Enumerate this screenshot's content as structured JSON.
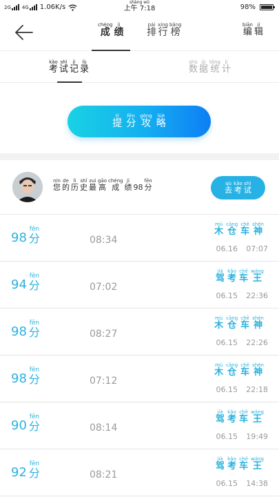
{
  "status_bar": {
    "network_left": "2G",
    "network_right": "4G",
    "speed": "1.06K/s",
    "time_py": "shàng wǔ",
    "time_text": "上午 7:18",
    "battery_text": "98%",
    "battery_level": 0.98
  },
  "header": {
    "tabs": [
      {
        "chars": [
          {
            "py": "chéng",
            "hz": "成"
          },
          {
            "py": "jì",
            "hz": "绩"
          }
        ]
      },
      {
        "chars": [
          {
            "py": "pái",
            "hz": "排"
          },
          {
            "py": "xíng",
            "hz": "行"
          },
          {
            "py": "bǎng",
            "hz": "榜"
          }
        ]
      }
    ],
    "edit": [
      {
        "py": "biān",
        "hz": "编"
      },
      {
        "py": "jí",
        "hz": "辑"
      }
    ]
  },
  "subtabs": [
    {
      "chars": [
        {
          "py": "kǎo",
          "hz": "考"
        },
        {
          "py": "shì",
          "hz": "试"
        },
        {
          "py": "jì",
          "hz": "记"
        },
        {
          "py": "lù",
          "hz": "录"
        }
      ]
    },
    {
      "chars": [
        {
          "py": "shù",
          "hz": "数"
        },
        {
          "py": "jù",
          "hz": "据"
        },
        {
          "py": "tǒng",
          "hz": "统"
        },
        {
          "py": "jì",
          "hz": "计"
        }
      ]
    }
  ],
  "strategy_button": [
    {
      "py": "tí",
      "hz": "提"
    },
    {
      "py": "fēn",
      "hz": "分"
    },
    {
      "py": "gōng",
      "hz": "攻"
    },
    {
      "py": "lüè",
      "hz": "略"
    }
  ],
  "best": {
    "chars": [
      {
        "py": "nín",
        "hz": "您"
      },
      {
        "py": "de",
        "hz": "的"
      },
      {
        "py": "lì",
        "hz": "历"
      },
      {
        "py": "shǐ",
        "hz": "史"
      },
      {
        "py": "zuì",
        "hz": "最"
      },
      {
        "py": "gāo",
        "hz": "高"
      },
      {
        "py": "chéng",
        "hz": "成"
      },
      {
        "py": "jì",
        "hz": "绩"
      }
    ],
    "score": "98",
    "unit": {
      "py": "fēn",
      "hz": "分"
    }
  },
  "exam_button": [
    {
      "py": "qù",
      "hz": "去"
    },
    {
      "py": "kǎo",
      "hz": "考"
    },
    {
      "py": "shì",
      "hz": "试"
    }
  ],
  "score_unit": {
    "py": "fēn",
    "hz": "分"
  },
  "records": [
    {
      "score": "98",
      "duration": "08:34",
      "title": [
        {
          "py": "mù",
          "hz": "木"
        },
        {
          "py": "cāng",
          "hz": "仓"
        },
        {
          "py": "chē",
          "hz": "车"
        },
        {
          "py": "shén",
          "hz": "神"
        }
      ],
      "date": "06.16",
      "time": "07:07"
    },
    {
      "score": "94",
      "duration": "07:02",
      "title": [
        {
          "py": "jià",
          "hz": "驾"
        },
        {
          "py": "kǎo",
          "hz": "考"
        },
        {
          "py": "chē",
          "hz": "车"
        },
        {
          "py": "wáng",
          "hz": "王"
        }
      ],
      "date": "06.15",
      "time": "22:36"
    },
    {
      "score": "98",
      "duration": "08:27",
      "title": [
        {
          "py": "mù",
          "hz": "木"
        },
        {
          "py": "cāng",
          "hz": "仓"
        },
        {
          "py": "chē",
          "hz": "车"
        },
        {
          "py": "shén",
          "hz": "神"
        }
      ],
      "date": "06.15",
      "time": "22:26"
    },
    {
      "score": "98",
      "duration": "07:12",
      "title": [
        {
          "py": "mù",
          "hz": "木"
        },
        {
          "py": "cāng",
          "hz": "仓"
        },
        {
          "py": "chē",
          "hz": "车"
        },
        {
          "py": "shén",
          "hz": "神"
        }
      ],
      "date": "06.15",
      "time": "22:18"
    },
    {
      "score": "90",
      "duration": "08:14",
      "title": [
        {
          "py": "jià",
          "hz": "驾"
        },
        {
          "py": "kǎo",
          "hz": "考"
        },
        {
          "py": "chē",
          "hz": "车"
        },
        {
          "py": "wáng",
          "hz": "王"
        }
      ],
      "date": "06.15",
      "time": "19:49"
    },
    {
      "score": "92",
      "duration": "08:21",
      "title": [
        {
          "py": "jià",
          "hz": "驾"
        },
        {
          "py": "kǎo",
          "hz": "考"
        },
        {
          "py": "chē",
          "hz": "车"
        },
        {
          "py": "wáng",
          "hz": "王"
        }
      ],
      "date": "06.15",
      "time": "14:38"
    }
  ],
  "colors": {
    "accent": "#2bb1dd",
    "button_gradient_start": "#19d2e3",
    "button_gradient_end": "#0e7ef5"
  }
}
